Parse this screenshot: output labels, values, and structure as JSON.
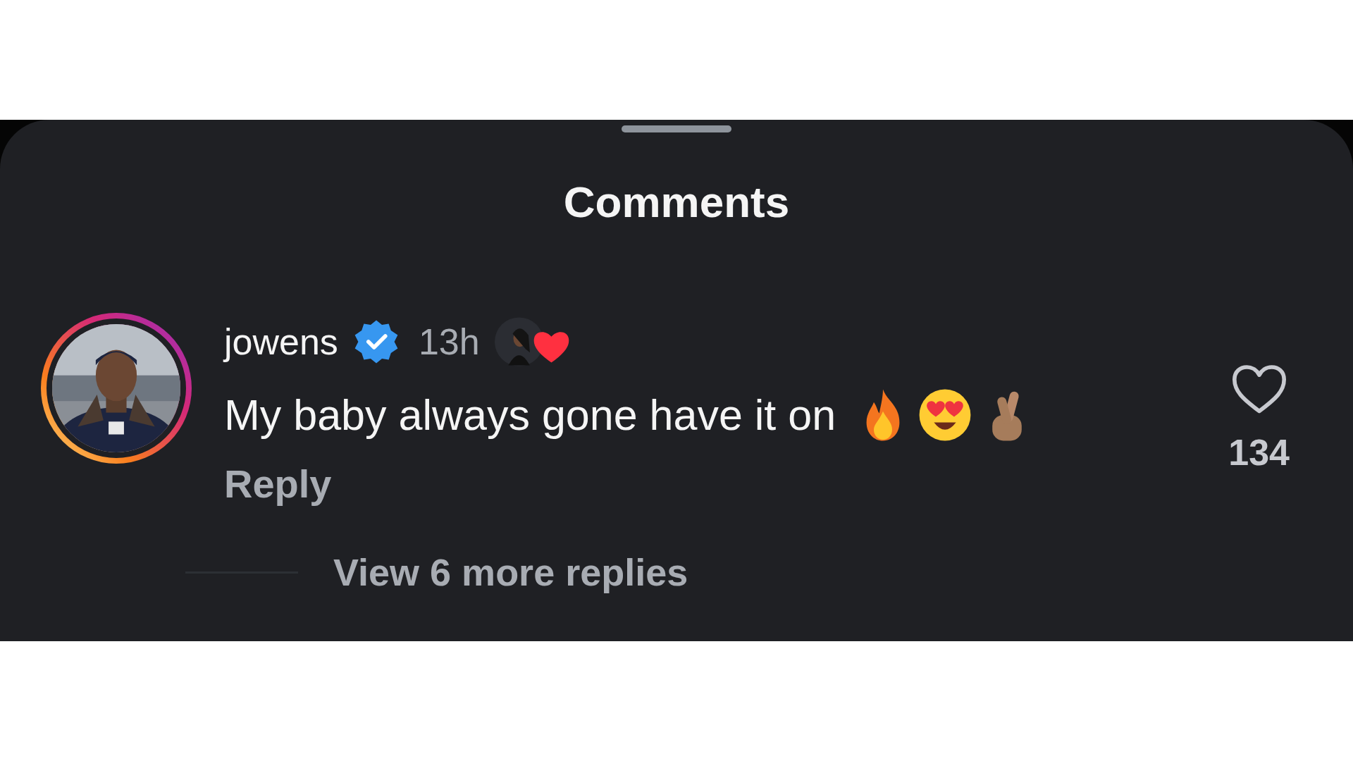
{
  "sheet": {
    "title": "Comments"
  },
  "comment": {
    "has_story": true,
    "username": "jowens",
    "verified": true,
    "time": "13h",
    "liked_by_author": true,
    "text": "My baby always gone have it on",
    "reply": "Reply",
    "liked": false,
    "likes": "134"
  },
  "view_replies": "View 6 more replies"
}
